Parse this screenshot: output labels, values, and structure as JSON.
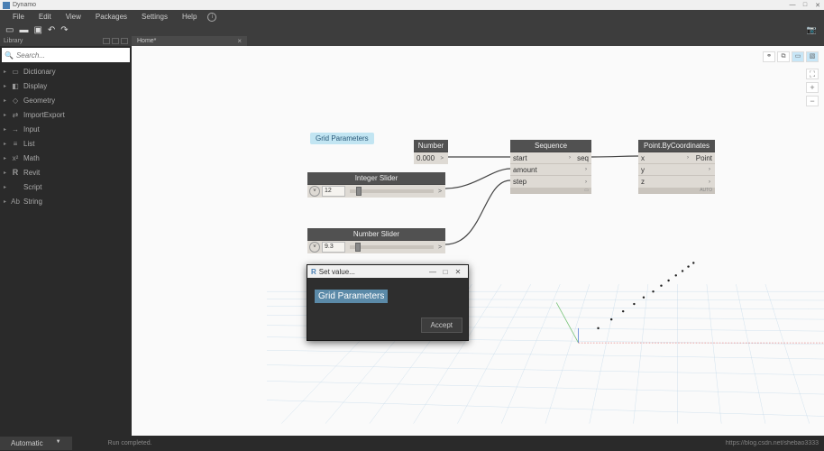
{
  "titlebar": {
    "app": "Dynamo"
  },
  "menu": {
    "file": "File",
    "edit": "Edit",
    "view": "View",
    "packages": "Packages",
    "settings": "Settings",
    "help": "Help"
  },
  "library": {
    "title": "Library",
    "search_placeholder": "Search...",
    "items": [
      {
        "icon": "▭",
        "label": "Dictionary"
      },
      {
        "icon": "◧",
        "label": "Display"
      },
      {
        "icon": "◇",
        "label": "Geometry"
      },
      {
        "icon": "⇄",
        "label": "ImportExport"
      },
      {
        "icon": "→",
        "label": "Input"
      },
      {
        "icon": "≡",
        "label": "List"
      },
      {
        "icon": "x²",
        "label": "Math"
      },
      {
        "icon": "R",
        "label": "Revit"
      },
      {
        "icon": "</>",
        "label": "Script"
      },
      {
        "icon": "Ab",
        "label": "String"
      }
    ]
  },
  "tabs": {
    "home": "Home*"
  },
  "nodes": {
    "group_label": "Grid Parameters",
    "number": {
      "title": "Number",
      "value": "0.000",
      "out": ">"
    },
    "int_slider": {
      "title": "Integer Slider",
      "value": "12",
      "out": ">"
    },
    "num_slider": {
      "title": "Number Slider",
      "value": "9.3",
      "out": ">"
    },
    "sequence": {
      "title": "Sequence",
      "ports": [
        "start",
        "amount",
        "step"
      ],
      "out": "seq",
      "foot": "▭"
    },
    "pbc": {
      "title": "Point.ByCoordinates",
      "ports": [
        "x",
        "y",
        "z"
      ],
      "out": "Point",
      "foot": "AUTO"
    }
  },
  "dialog": {
    "title": "Set value...",
    "value": "Grid Parameters",
    "accept": "Accept"
  },
  "status": {
    "mode": "Automatic",
    "msg": "Run completed.",
    "url": "https://blog.csdn.net/shebao3333"
  }
}
